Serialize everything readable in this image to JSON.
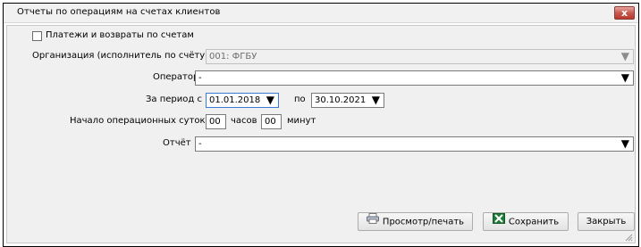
{
  "window": {
    "title": "Отчеты по операциям на счетах клиентов",
    "close_glyph": "x"
  },
  "form": {
    "checkbox_label": "Платежи и возвраты по счетам",
    "org_label": "Организация (исполнитель по счёту)",
    "org_value": "001: ФГБУ",
    "operator_label": "Оператор",
    "operator_value": "-",
    "period_label": "За период с",
    "period_from": "01.01.2018",
    "period_to_label": "по",
    "period_to": "30.10.2021",
    "day_start_label": "Начало операционных суток",
    "hours_value": "00",
    "hours_label": "часов",
    "minutes_value": "00",
    "minutes_label": "минут",
    "report_label": "Отчёт",
    "report_value": "-",
    "dropdown_glyph": "▼"
  },
  "buttons": {
    "preview": "Просмотр/печать",
    "save": "Сохранить",
    "close": "Закрыть"
  },
  "icons": {
    "preview": "printer-icon",
    "save": "excel-icon"
  },
  "colors": {
    "close_button": "#c75a4f",
    "focus_border": "#3a7bd5",
    "excel_green": "#1e7b3a"
  }
}
